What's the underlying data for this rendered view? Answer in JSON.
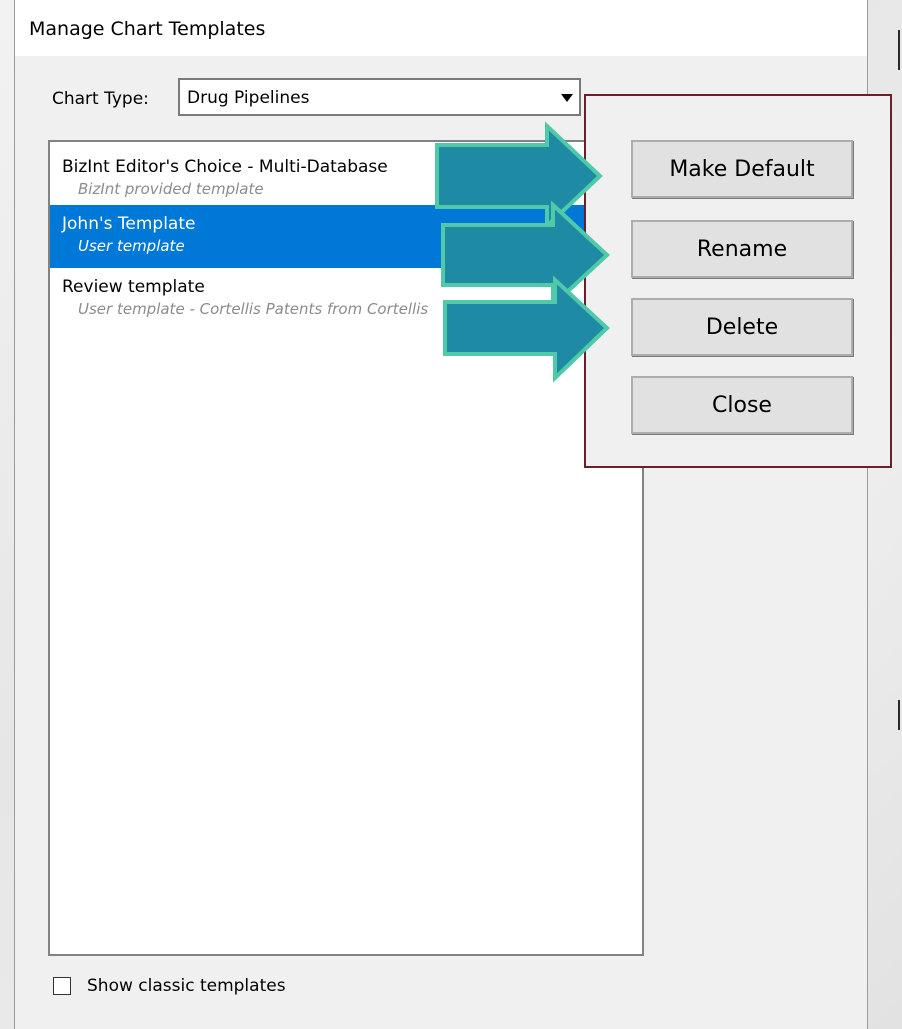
{
  "dialog": {
    "title": "Manage Chart Templates"
  },
  "chart_type": {
    "label": "Chart Type:",
    "value": "Drug Pipelines"
  },
  "templates": [
    {
      "name": "BizInt Editor's Choice - Multi-Database",
      "subtitle": "BizInt provided template",
      "selected": false
    },
    {
      "name": "John's Template",
      "subtitle": "User template",
      "selected": true
    },
    {
      "name": "Review template",
      "subtitle": "User template - Cortellis Patents from Cortellis",
      "selected": false
    }
  ],
  "buttons": {
    "make_default": "Make Default",
    "rename": "Rename",
    "delete": "Delete",
    "close": "Close"
  },
  "show_classic": {
    "label": "Show classic templates",
    "checked": false
  },
  "colors": {
    "selection": "#0078d7",
    "arrow_fill": "#1f8aa4",
    "arrow_outline": "#4fc9a8",
    "panel_border": "#6b1f2a"
  },
  "icons": [
    "dropdown-arrow-icon",
    "arrow-right-icon"
  ]
}
